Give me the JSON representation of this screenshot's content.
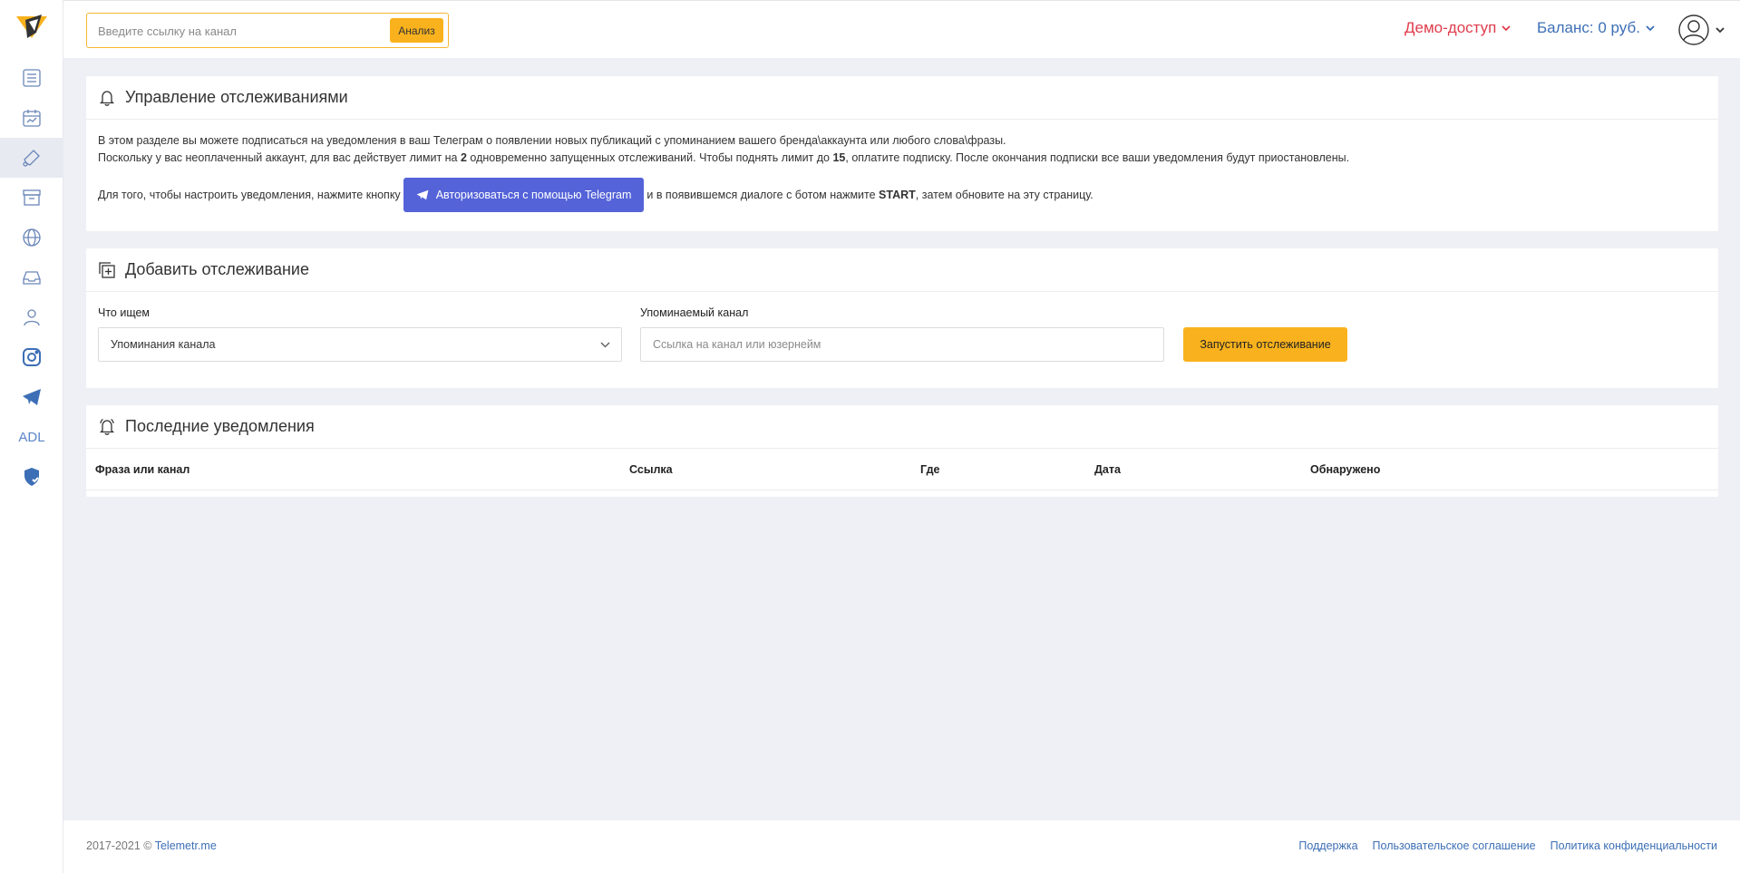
{
  "topbar": {
    "search_placeholder": "Введите ссылку на канал",
    "search_button": "Анализ",
    "demo_label": "Демо-доступ",
    "balance_label": "Баланс: 0 руб."
  },
  "sidebar": {
    "items": [
      {
        "icon": "list-icon"
      },
      {
        "icon": "calendar-stats-icon"
      },
      {
        "icon": "bell-icon",
        "active": true
      },
      {
        "icon": "archive-icon"
      },
      {
        "icon": "globe-icon"
      },
      {
        "icon": "inbox-icon"
      },
      {
        "icon": "users-icon"
      },
      {
        "icon": "instagram-icon"
      },
      {
        "icon": "telegram-icon"
      },
      {
        "label": "ADL"
      },
      {
        "icon": "shield-check-icon"
      }
    ]
  },
  "tracking": {
    "title": "Управление отслеживаниями",
    "line1": "В этом разделе вы можете подписаться на уведомления в ваш Телеграм о появлении новых публикаций с упоминанием вашего бренда\\аккаунта или любого слова\\фразы.",
    "line2_a": "Поскольку у вас неоплаченный аккаунт, для вас действует лимит на ",
    "line2_limit": "2",
    "line2_b": " одновременно запущенных отслеживаний. Чтобы поднять лимит до ",
    "line2_max": "15",
    "line2_c": ", оплатите подписку. После окончания подписки все ваши уведомления будут приостановлены.",
    "auth_before": "Для того, чтобы настроить уведомления, нажмите кнопку",
    "auth_button": "Авторизоваться с помощью Telegram",
    "auth_after_a": "и в появившемся диалоге с ботом нажмите ",
    "auth_start": "START",
    "auth_after_b": ", затем обновите на эту страницу."
  },
  "add": {
    "title": "Добавить отслеживание",
    "what_label": "Что ищем",
    "what_value": "Упоминания канала",
    "channel_label": "Упоминаемый канал",
    "channel_placeholder": "Ссылка на канал или юзернейм",
    "start_button": "Запустить отслеживание"
  },
  "notifications": {
    "title": "Последние уведомления",
    "columns": [
      "Фраза или канал",
      "Ссылка",
      "Где",
      "Дата",
      "Обнаружено"
    ]
  },
  "footer": {
    "copyright": "2017-2021 © ",
    "brand_link": "Telemetr.me",
    "links": [
      "Поддержка",
      "Пользовательское соглашение",
      "Политика конфиденциальности"
    ]
  },
  "colors": {
    "accent": "#f9b21d",
    "demo": "#e03c4c",
    "link": "#3d6fb6",
    "telegram_button": "#5463d8"
  }
}
